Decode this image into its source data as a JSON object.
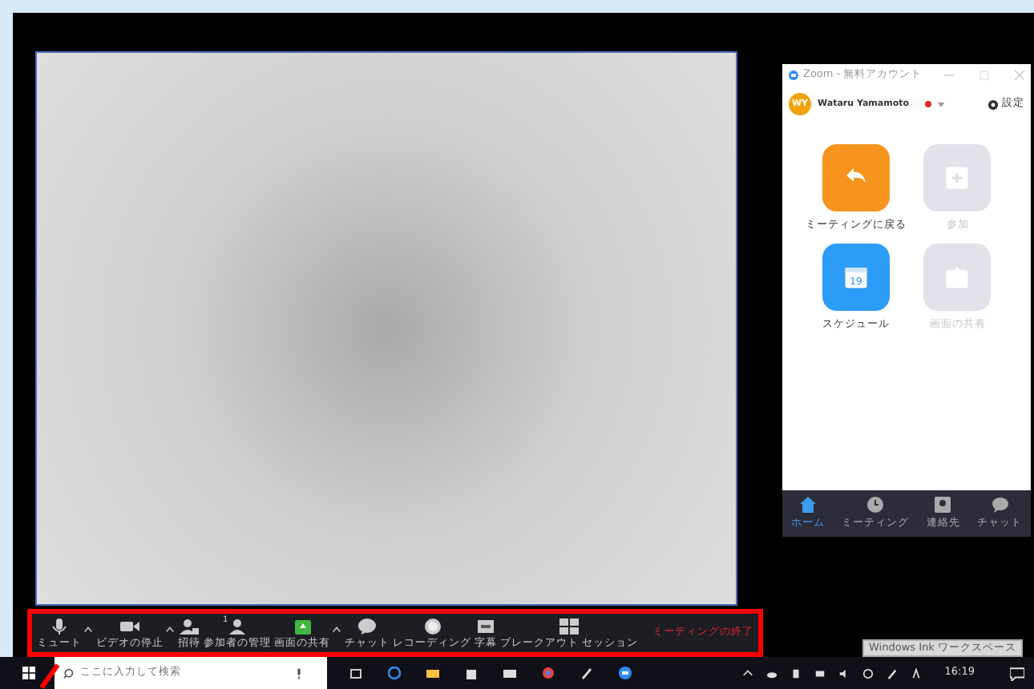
{
  "meeting": {
    "toolbar": [
      {
        "kind": "mic",
        "label": "ミュート",
        "caret": true
      },
      {
        "kind": "video",
        "label": "ビデオの停止",
        "caret": true
      },
      {
        "kind": "invite",
        "label": "招待",
        "caret": false
      },
      {
        "kind": "participants",
        "label": "参加者の管理",
        "count": "1",
        "caret": false
      },
      {
        "kind": "share",
        "label": "画面の共有",
        "caret": true
      },
      {
        "kind": "chat",
        "label": "チャット",
        "caret": false
      },
      {
        "kind": "record",
        "label": "レコーディング",
        "caret": false
      },
      {
        "kind": "cc",
        "label": "字幕",
        "caret": false
      },
      {
        "kind": "breakout",
        "label": "ブレークアウト セッション",
        "caret": false
      }
    ],
    "end_button": "ミーティングの終了"
  },
  "zoom_window": {
    "title": "Zoom - 無料アカウント",
    "user": {
      "initials": "WY",
      "name": "Wataru Yamamoto",
      "status_dot": {
        "color": "#e02828"
      }
    },
    "settings": "設定",
    "home_buttons": [
      {
        "kind": "return",
        "label": "ミーティングに戻る",
        "color": "#f7941d",
        "disabled": false
      },
      {
        "kind": "join",
        "label": "参加",
        "color": "#e2e2ea",
        "disabled": true
      },
      {
        "kind": "calendar",
        "label": "スケジュール",
        "color": "#2d9cf7",
        "disabled": false,
        "date": "19"
      },
      {
        "kind": "share",
        "label": "画面の共有",
        "color": "#e2e2ea",
        "disabled": true
      }
    ],
    "tabs": [
      {
        "kind": "home",
        "label": "ホーム",
        "selected": true
      },
      {
        "kind": "clock",
        "label": "ミーティング",
        "selected": false
      },
      {
        "kind": "contacts",
        "label": "連絡先",
        "selected": false
      },
      {
        "kind": "chat",
        "label": "チャット",
        "selected": false
      }
    ]
  },
  "taskbar": {
    "search_placeholder": "ここに入力して検索",
    "tooltip": "Windows Ink ワークスペース",
    "time": "16:19"
  }
}
